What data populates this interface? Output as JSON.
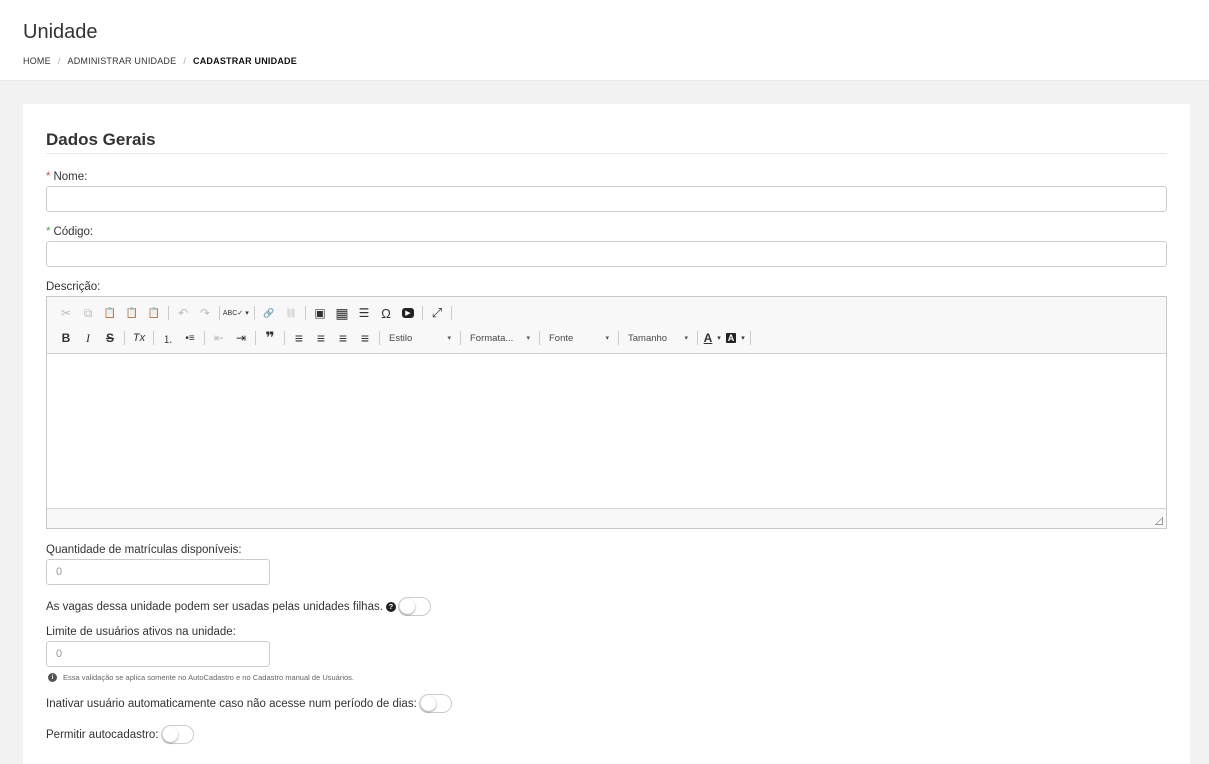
{
  "header": {
    "title": "Unidade",
    "breadcrumb": [
      "HOME",
      "ADMINISTRAR UNIDADE",
      "CADASTRAR UNIDADE"
    ],
    "breadcrumb_separator": "/"
  },
  "form": {
    "section_title": "Dados Gerais",
    "required_mark": "*",
    "nome_label": "Nome:",
    "codigo_label": "Código:",
    "descricao_label": "Descrição:",
    "matriculas_label": "Quantidade de matrículas disponíveis:",
    "matriculas_placeholder": "0",
    "vagas_label": "As vagas dessa unidade podem ser usadas pelas unidades filhas.",
    "help_glyph": "?",
    "limite_label": "Limite de usuários ativos na unidade:",
    "limite_placeholder": "0",
    "limite_hint": "Essa validação se aplica somente no AutoCadastro e no Cadastro manual de Usuários.",
    "info_glyph": "i",
    "inativar_label": "Inativar usuário automaticamente caso não acesse num período de dias:",
    "autocadastro_label": "Permitir autocadastro:"
  },
  "editor": {
    "combos": {
      "estilo": "Estilo",
      "formatacao": "Formata...",
      "fonte": "Fonte",
      "tamanho": "Tamanho"
    },
    "icons": {
      "cut": "✂",
      "copy": "⧉",
      "paste": "📋",
      "paste_text": "📋",
      "paste_word": "📋",
      "undo": "↶",
      "redo": "↷",
      "spellcheck": "ABC✓",
      "link": "🔗",
      "unlink": "⛓",
      "image": "▣",
      "table": "▦",
      "hr": "☰",
      "special_char": "Ω",
      "youtube": "▶",
      "maximize": "⤢",
      "bold": "B",
      "italic": "I",
      "strike": "S",
      "remove_format": "Tx",
      "numbered_list": "⒈",
      "bulleted_list": "•≡",
      "outdent": "⇤",
      "indent": "⇥",
      "blockquote": "❞",
      "align_left": "≡",
      "align_center": "≡",
      "align_right": "≡",
      "justify": "≡",
      "text_color": "A",
      "bg_color": "A",
      "caret": "▾"
    }
  },
  "colors": {
    "required_red": "#d9534f",
    "required_green": "#4cae4c",
    "page_bg": "#f2f2f2"
  }
}
